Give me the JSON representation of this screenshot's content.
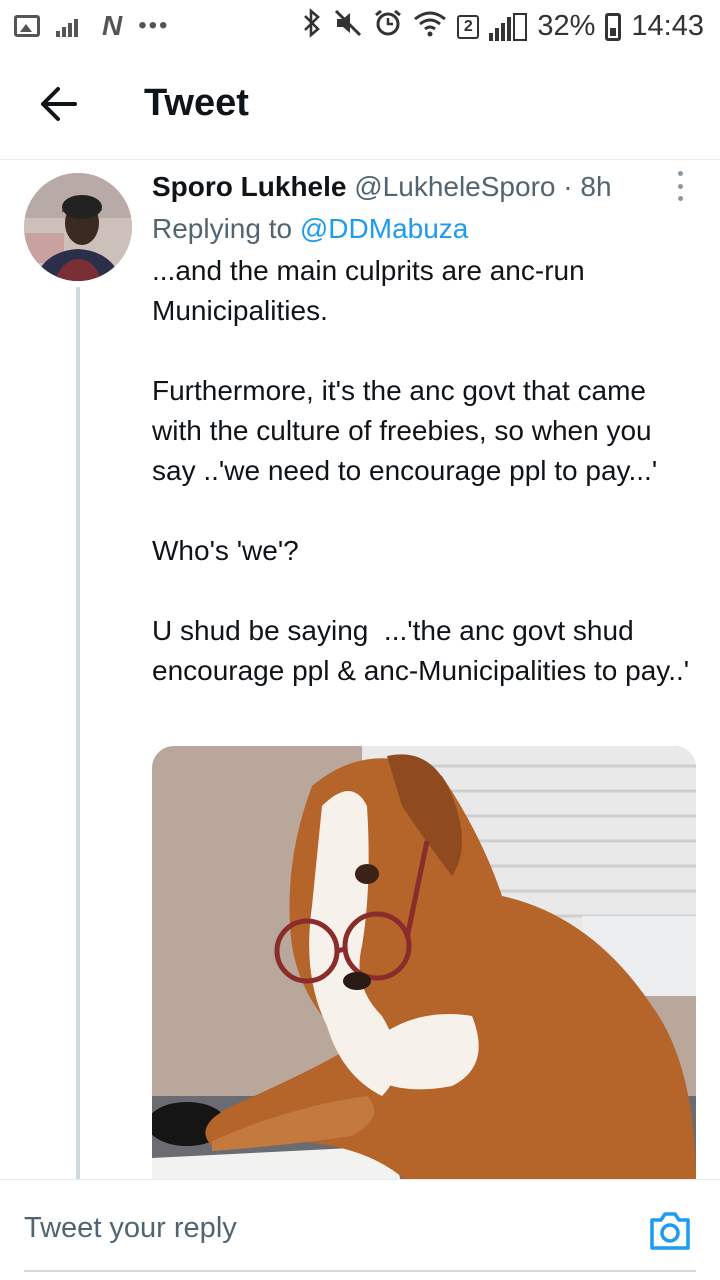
{
  "status_bar": {
    "battery": "32%",
    "time": "14:43",
    "notification_badge": "2",
    "icons": [
      "image-icon",
      "signal-bars-icon",
      "n-icon",
      "more-dots-icon",
      "bluetooth-icon",
      "mute-icon",
      "alarm-icon",
      "wifi-icon",
      "sim-badge-icon",
      "cell-signal-icon",
      "battery-icon"
    ]
  },
  "header": {
    "title": "Tweet",
    "back_icon": "arrow-left-icon"
  },
  "tweet": {
    "author_name": "Sporo Lukhele",
    "author_handle": "@LukheleSporo",
    "separator": "·",
    "time_ago": "8h",
    "replying_prefix": "Replying to",
    "replying_to": "@DDMabuza",
    "text": "...and the main culprits are anc-run Municipalities.\n\nFurthermore, it's the anc govt that came with the culture of freebies, so when you say ..'we need to encourage ppl to pay...'\n\nWho's 'we'?\n\nU shud be saying  ...'the anc govt shud encourage ppl & anc-Municipalities to pay..'",
    "colors": {
      "link": "#1d9bf0",
      "secondary": "#536471"
    }
  },
  "reply_bar": {
    "placeholder": "Tweet your reply",
    "camera_icon": "camera-icon",
    "accent": "#1d9bf0"
  }
}
